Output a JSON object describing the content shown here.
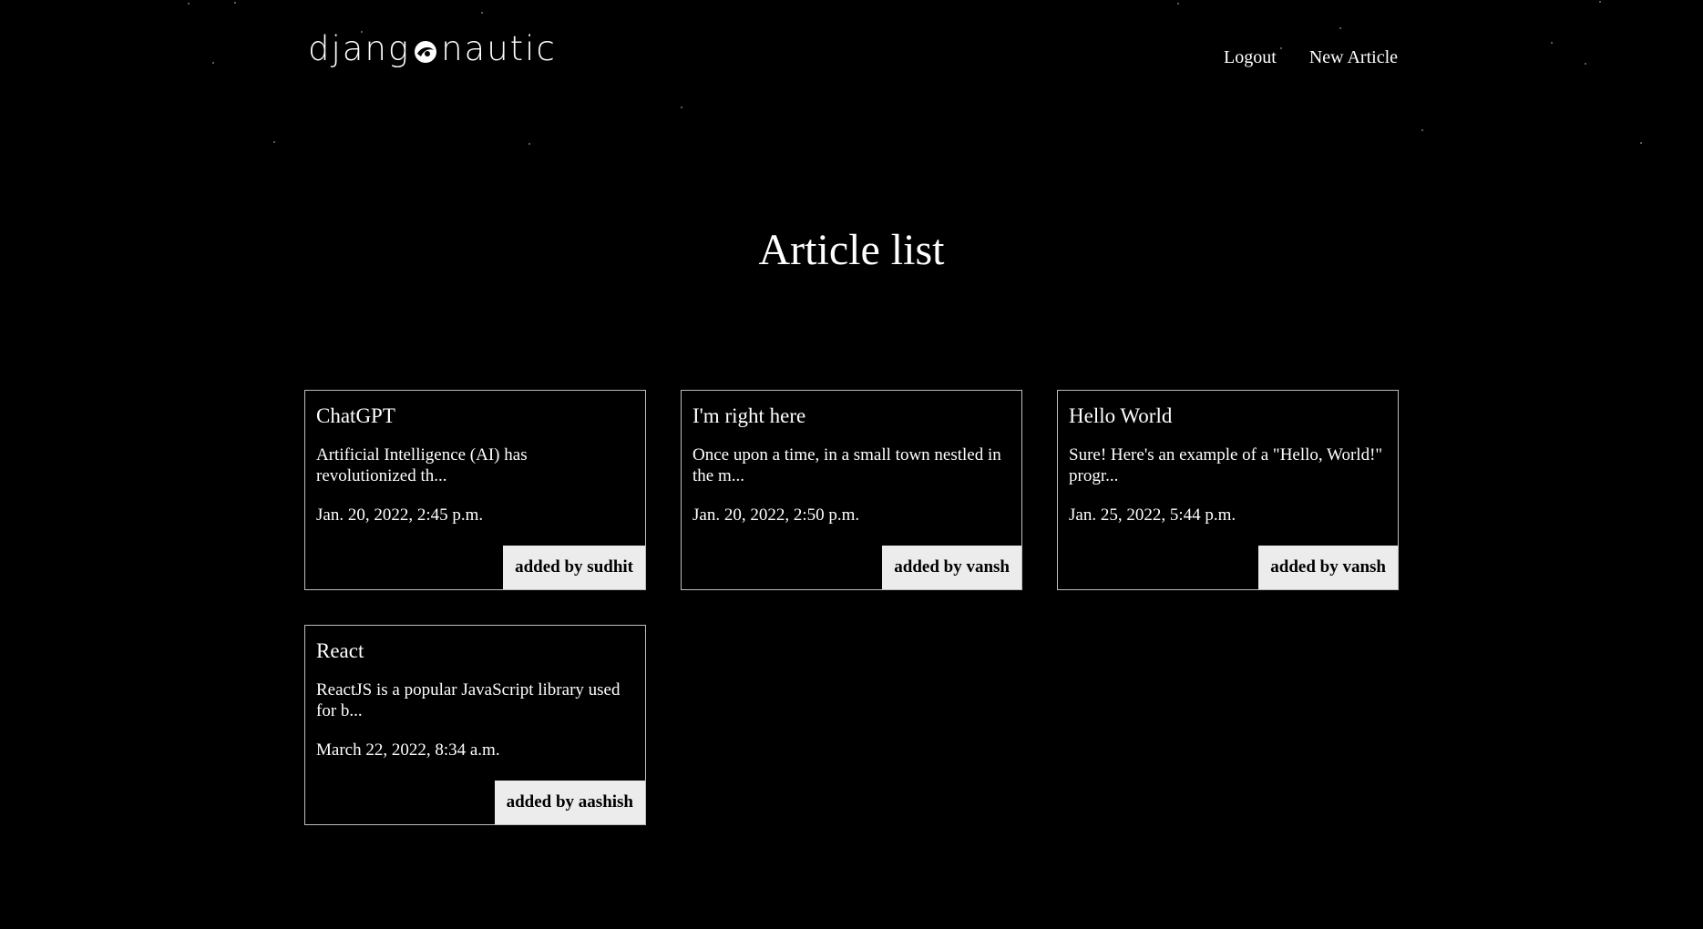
{
  "header": {
    "logo_left": "djang",
    "logo_right": "nautic",
    "nav": {
      "logout": "Logout",
      "new_article": "New Article"
    }
  },
  "main": {
    "title": "Article list",
    "articles": [
      {
        "title": "ChatGPT",
        "excerpt": "Artificial Intelligence (AI) has revolutionized th...",
        "date": "Jan. 20, 2022, 2:45 p.m.",
        "author_label": "added by sudhit"
      },
      {
        "title": "I'm right here",
        "excerpt": "Once upon a time, in a small town nestled in the m...",
        "date": "Jan. 20, 2022, 2:50 p.m.",
        "author_label": "added by vansh"
      },
      {
        "title": "Hello World",
        "excerpt": "Sure! Here's an example of a \"Hello, World!\" progr...",
        "date": "Jan. 25, 2022, 5:44 p.m.",
        "author_label": "added by vansh"
      },
      {
        "title": "React",
        "excerpt": "ReactJS is a popular JavaScript library used for b...",
        "date": "March 22, 2022, 8:34 a.m.",
        "author_label": "added by aashish"
      }
    ]
  },
  "colors": {
    "background": "#000000",
    "text": "#ffffff",
    "card_border": "#bdbdbd",
    "author_badge_bg": "#ececec",
    "author_badge_text": "#000000"
  },
  "icons": {
    "logo_o": "rocket-orbit-icon"
  }
}
